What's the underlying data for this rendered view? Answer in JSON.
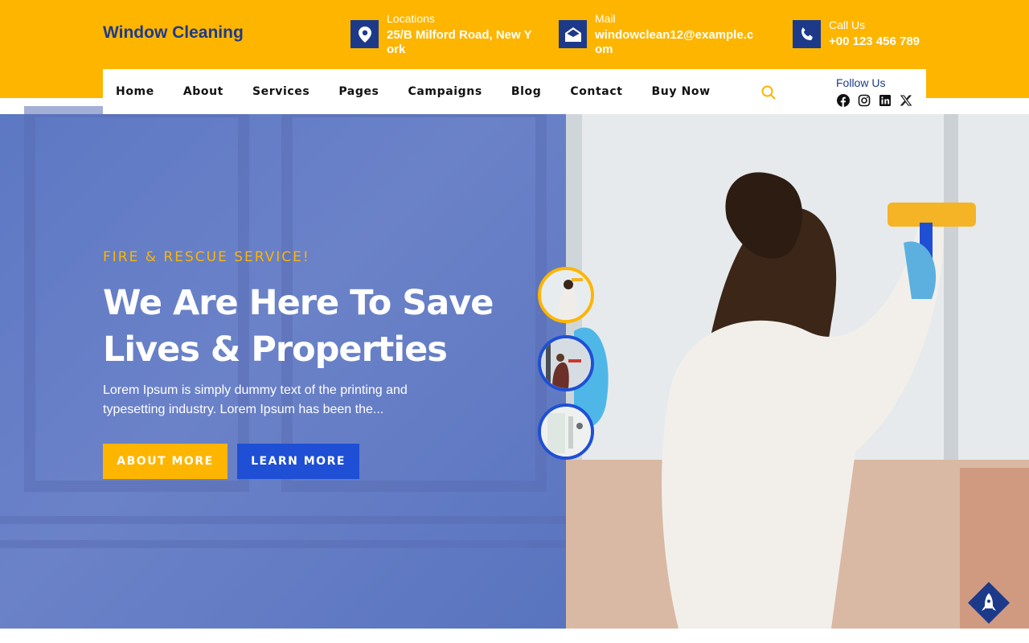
{
  "brand": {
    "name": "Window Cleaning"
  },
  "contacts": [
    {
      "icon": "location-pin-icon",
      "title": "Locations",
      "value": "25/B Milford Road, New York"
    },
    {
      "icon": "envelope-icon",
      "title": "Mail",
      "value": "windowclean12@example.com"
    },
    {
      "icon": "phone-icon",
      "title": "Call Us",
      "value": "+00 123 456 789"
    }
  ],
  "nav": {
    "items": [
      "Home",
      "About",
      "Services",
      "Pages",
      "Campaigns",
      "Blog",
      "Contact",
      "Buy Now"
    ],
    "search_icon": "search-icon"
  },
  "follow": {
    "title": "Follow Us",
    "icons": [
      "facebook-icon",
      "instagram-icon",
      "linkedin-icon",
      "x-icon"
    ]
  },
  "hero": {
    "kicker": "FIRE & RESCUE SERVICE!",
    "headline": "We Are Here To Save Lives & Properties",
    "paragraph": "Lorem Ipsum is simply dummy text of the printing and typesetting industry. Lorem Ipsum has been the...",
    "buttons": {
      "primary": "ABOUT MORE",
      "secondary": "LEARN MORE"
    }
  },
  "colors": {
    "accent": "#fdb500",
    "brand_blue": "#1d3a8a",
    "button_blue": "#1f4fd4",
    "overlay_blue": "#6b82c8"
  }
}
